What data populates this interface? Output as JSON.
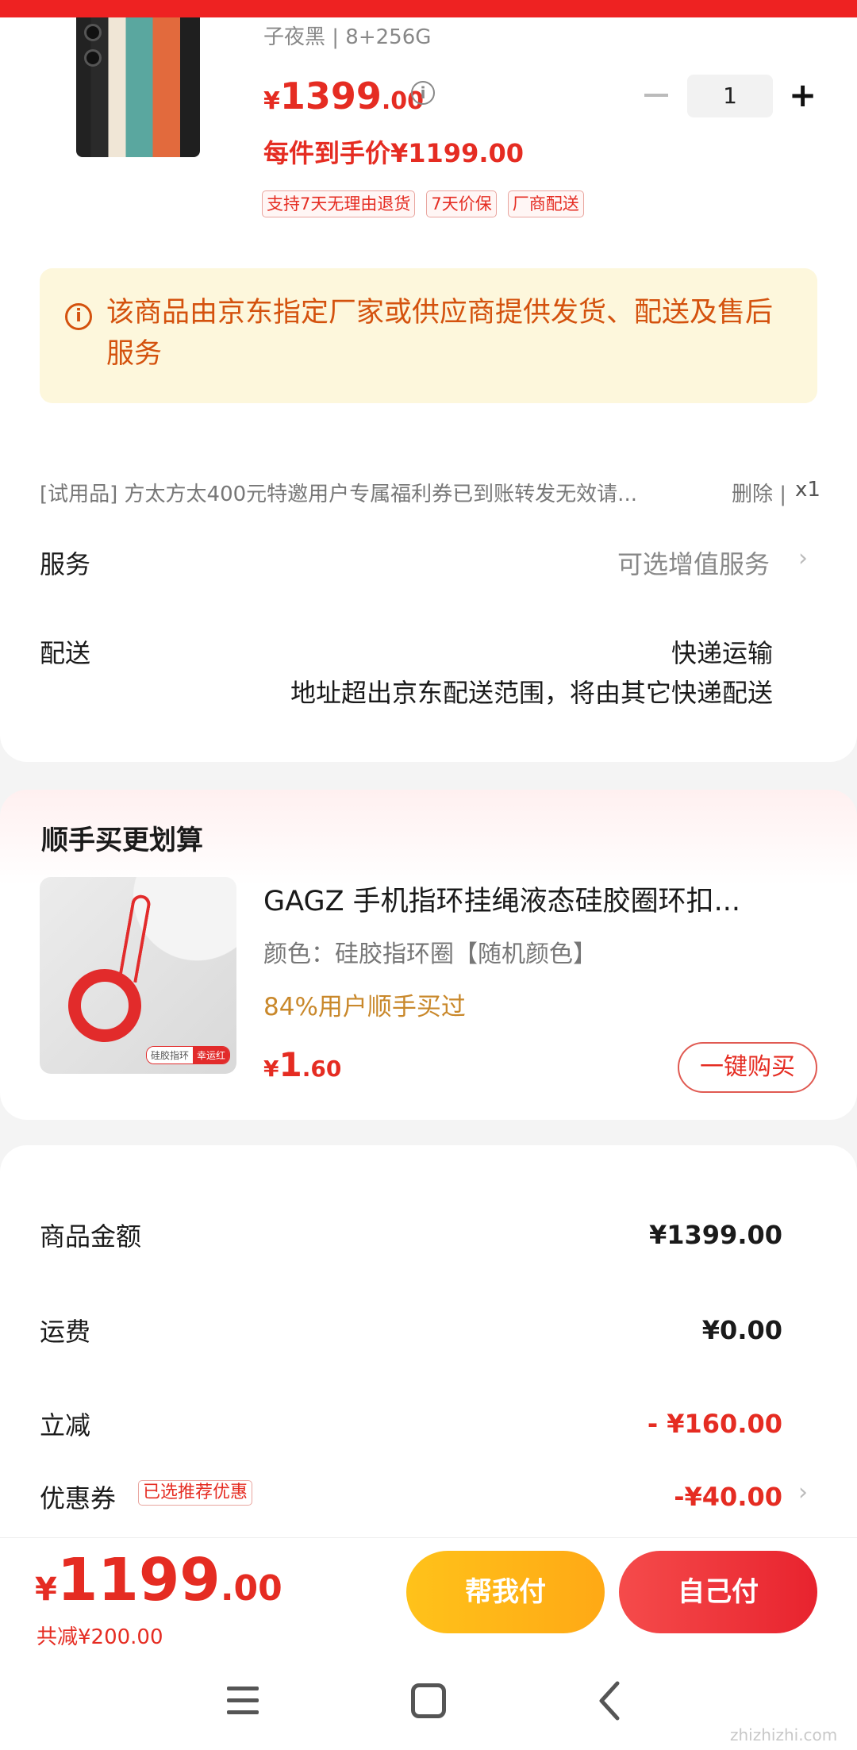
{
  "product": {
    "spec": "子夜黑 | 8+256G",
    "price_yen": "¥",
    "price_int": "1399",
    "price_dec": ".00",
    "quantity": "1",
    "per_price": "每件到手价¥1199.00",
    "tags": [
      "支持7天无理由退货",
      "7天价保",
      "厂商配送"
    ],
    "notice": "该商品由京东指定厂家或供应商提供发货、配送及售后服务"
  },
  "trial": {
    "text": "[试用品]   方太方太400元特邀用户专属福利券已到账转发无效请...",
    "delete": "删除",
    "qty": "x1"
  },
  "service": {
    "label": "服务",
    "value": "可选增值服务"
  },
  "delivery": {
    "label": "配送",
    "method": "快递运输",
    "note": "地址超出京东配送范围，将由其它快递配送"
  },
  "upsell": {
    "title": "顺手买更划算",
    "name": "GAGZ 手机指环挂绳液态硅胶圈环扣...",
    "attr": "颜色：硅胶指环圈【随机颜色】",
    "stat": "84%用户顺手买过",
    "price_yen": "¥",
    "price_int": "1",
    "price_dec": ".60",
    "buy_label": "一键购买",
    "img_badge_1": "硅胶指环",
    "img_badge_2": "幸运红"
  },
  "summary": {
    "goods_label": "商品金额",
    "goods_val": "¥1399.00",
    "freight_label": "运费",
    "freight_val": "¥0.00",
    "discount_label": "立减",
    "discount_val": "- ¥160.00",
    "coupon_label": "优惠券",
    "coupon_tag": "已选推荐优惠",
    "coupon_val": "-¥40.00"
  },
  "bottom": {
    "total_yen": "¥",
    "total_int": "1199",
    "total_dec": ".00",
    "saved": "共减¥200.00",
    "help_pay": "帮我付",
    "self_pay": "自己付"
  },
  "watermark": "zhizhizhi.com",
  "colors": {
    "accent": "#e52c22",
    "notice_bg": "#fdf7dc",
    "notice_text": "#d4520e",
    "yellow_btn": "#ffb819"
  }
}
